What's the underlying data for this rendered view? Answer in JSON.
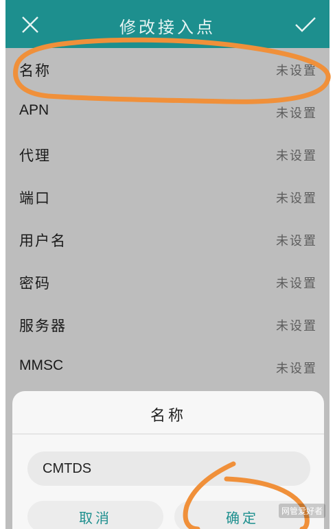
{
  "header": {
    "title": "修改接入点",
    "close_icon": "close-icon",
    "confirm_icon": "check-icon"
  },
  "apn_fields": [
    {
      "label": "名称",
      "value": "未设置"
    },
    {
      "label": "APN",
      "value": "未设置"
    },
    {
      "label": "代理",
      "value": "未设置"
    },
    {
      "label": "端口",
      "value": "未设置"
    },
    {
      "label": "用户名",
      "value": "未设置"
    },
    {
      "label": "密码",
      "value": "未设置"
    },
    {
      "label": "服务器",
      "value": "未设置"
    },
    {
      "label": "MMSC",
      "value": "未设置"
    }
  ],
  "dialog": {
    "title": "名称",
    "input_value": "CMTDS",
    "cancel_label": "取消",
    "confirm_label": "确定"
  },
  "watermark": "网管爱好者",
  "colors": {
    "header_bg": "#1d8f8e",
    "annotation_orange": "#f0903a",
    "dim_overlay": "#bdbdbd",
    "button_text": "#1d8f8e"
  }
}
